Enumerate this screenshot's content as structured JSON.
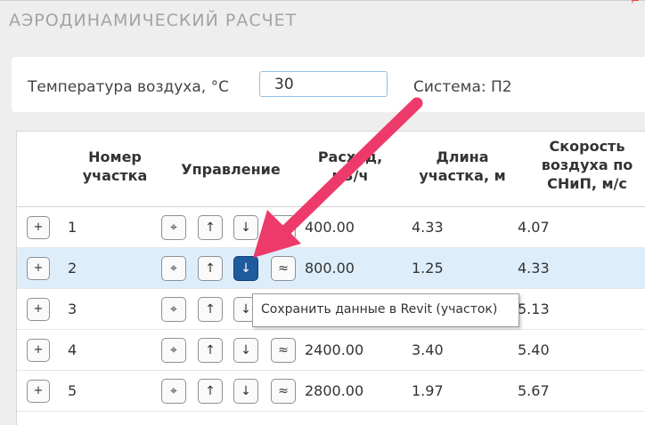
{
  "window": {
    "title": "АЭРОДИНАМИЧЕСКИЙ РАСЧЕТ"
  },
  "params": {
    "temperature_label": "Температура воздуха, °C",
    "temperature_value": "30",
    "system_label": "Система: П2"
  },
  "table": {
    "columns": {
      "section_line1": "Номер",
      "section_line2": "участка",
      "control": "Управление",
      "flow_line1": "Расход,",
      "flow_line2": "м3/ч",
      "length_line1": "Длина",
      "length_line2": "участка, м",
      "speed_line1": "Скорость",
      "speed_line2": "воздуха по",
      "speed_line3": "СНиП, м/с"
    },
    "buttons": {
      "expand": "+",
      "locate": "⌖",
      "up": "↑",
      "save": "↓",
      "approx": "≈"
    },
    "rows": [
      {
        "number": "1",
        "flow": "400.00",
        "length": "4.33",
        "speed": "4.07"
      },
      {
        "number": "2",
        "flow": "800.00",
        "length": "1.25",
        "speed": "4.33",
        "selected": true
      },
      {
        "number": "3",
        "flow": "",
        "length": "",
        "speed": "5.13"
      },
      {
        "number": "4",
        "flow": "2400.00",
        "length": "3.40",
        "speed": "5.40"
      },
      {
        "number": "5",
        "flow": "2800.00",
        "length": "1.97",
        "speed": "5.67"
      }
    ]
  },
  "tooltip": {
    "text": "Сохранить данные в Revit (участок)"
  },
  "colors": {
    "selected_row": "#ddeefa",
    "pressed_button": "#1f5c9e",
    "annotation_arrow": "#ee3a6a"
  }
}
